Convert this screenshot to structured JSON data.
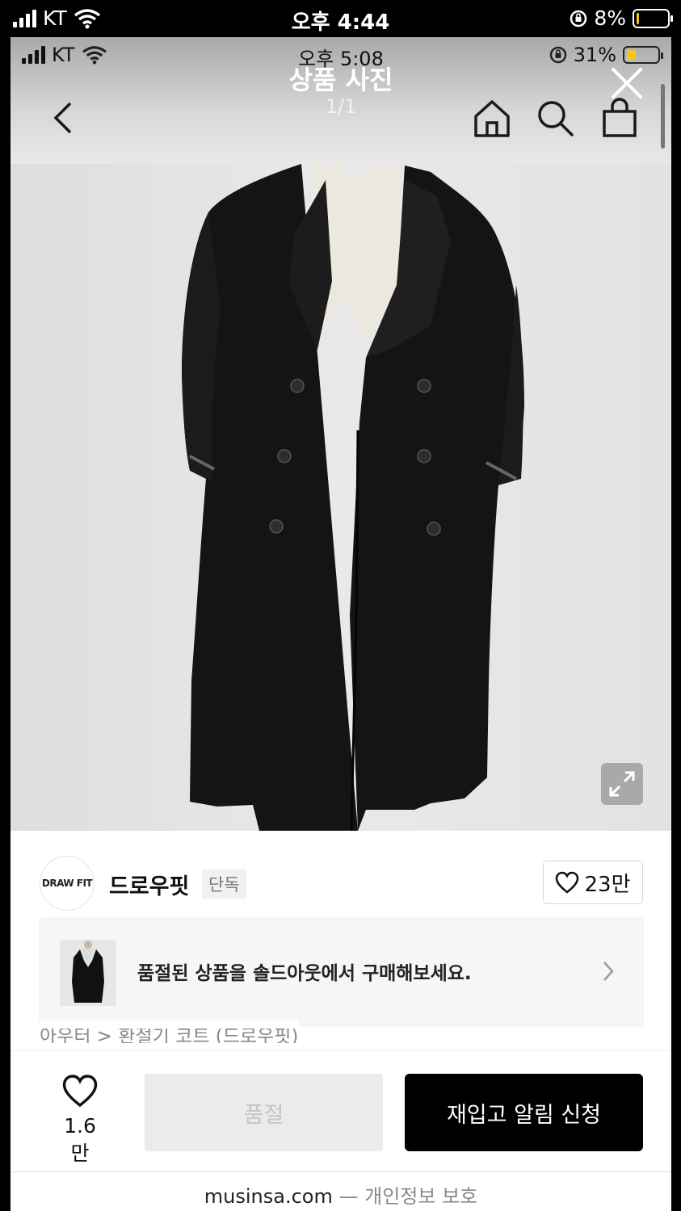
{
  "outer_status": {
    "carrier": "KT",
    "time": "오후 4:44",
    "battery": "8%",
    "battery_level": 0.08
  },
  "inner_status": {
    "carrier": "KT",
    "time": "오후 5:08",
    "battery": "31%",
    "battery_level": 0.31
  },
  "overlay": {
    "title": "상품 사진",
    "counter": "1/1"
  },
  "icons": {
    "back": "chevron-left-icon",
    "home": "home-icon",
    "search": "search-icon",
    "bag": "shopping-bag-icon",
    "close": "close-icon",
    "expand": "expand-icon",
    "heart": "heart-icon"
  },
  "seller": {
    "logo_text": "DRAW FIT",
    "name": "드로우핏",
    "tag": "단독",
    "likes": "23만"
  },
  "banner": {
    "text": "품절된 상품을 솔드아웃에서 구매해보세요."
  },
  "breadcrumb": "아우터 > 환절기 코트 (드로우핏)",
  "bottom": {
    "wish_count": "1.6만",
    "soldout_label": "품절",
    "restock_label": "재입고 알림 신청"
  },
  "url_bar": {
    "domain": "musinsa.com",
    "separator": "—",
    "privacy": "개인정보 보호"
  },
  "colors": {
    "accent": "#000000",
    "battery_low": "#f3c623",
    "soldout_bg": "#ebebeb"
  }
}
